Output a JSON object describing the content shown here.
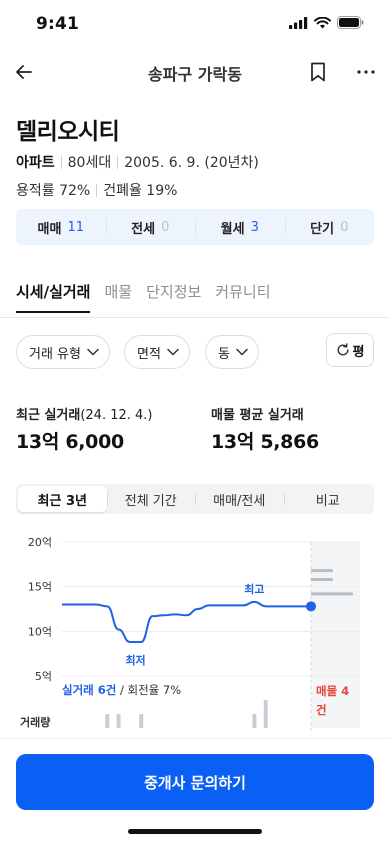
{
  "status_bar": {
    "time": "9:41"
  },
  "nav": {
    "title": "송파구 가락동"
  },
  "complex": {
    "name": "델리오시티",
    "type": "아파트",
    "households": "80세대",
    "approval_date": "2005. 6. 9. (20년차)",
    "floor_area_ratio": "용적률 72%",
    "building_coverage": "건폐율 19%"
  },
  "deal_counts": [
    {
      "label": "매매",
      "count": "11",
      "active": true
    },
    {
      "label": "전세",
      "count": "0",
      "active": false
    },
    {
      "label": "월세",
      "count": "3",
      "active": true
    },
    {
      "label": "단기",
      "count": "0",
      "active": false
    }
  ],
  "tabs": [
    "시세/실거래",
    "매물",
    "단지정보",
    "커뮤니티"
  ],
  "filters": {
    "deal_type": "거래 유형",
    "area": "면적",
    "dong": "동",
    "unit": "평"
  },
  "prices": {
    "recent_label": "최근 실거래",
    "recent_date": "(24. 12. 4.)",
    "recent_value": "13억 6,000",
    "listing_label": "매물 평균 실거래",
    "listing_value": "13억 5,866"
  },
  "periods": [
    "최근 3년",
    "전체 기간",
    "매매/전세",
    "비교"
  ],
  "chart_data": {
    "type": "line",
    "y_unit": "억",
    "y_ticks": [
      "20억",
      "15억",
      "10억",
      "5억"
    ],
    "ylim": [
      5,
      20
    ],
    "grid": true,
    "series": [
      {
        "values": [
          13,
          13,
          13,
          13,
          12.8,
          10.2,
          8.8,
          8.8,
          11.7,
          11.8,
          11.9,
          11.8,
          12.5,
          12.9,
          12.9,
          12.9,
          12.9,
          13.3,
          12.8,
          12.8,
          12.8,
          12.8,
          12.8
        ]
      }
    ],
    "annotations": {
      "max_label": "최고",
      "min_label": "최저"
    },
    "listing_markers": [
      16.8,
      15.8,
      14.2
    ],
    "volume": [
      0,
      0,
      0,
      0,
      1,
      1,
      0,
      1,
      0,
      0,
      0,
      0,
      0,
      0,
      0,
      0,
      0,
      1,
      2,
      0,
      0,
      0,
      0
    ]
  },
  "chart_footer": {
    "deals": "실거래 6건",
    "rotation": " / 회전율 7%",
    "listing_count": "매물 4건",
    "volume_label": "거래량"
  },
  "cta": {
    "label": "중개사 문의하기"
  },
  "colors": {
    "accent": "#0a5ff5",
    "line": "#1e63e6",
    "alert": "#e8453c"
  }
}
